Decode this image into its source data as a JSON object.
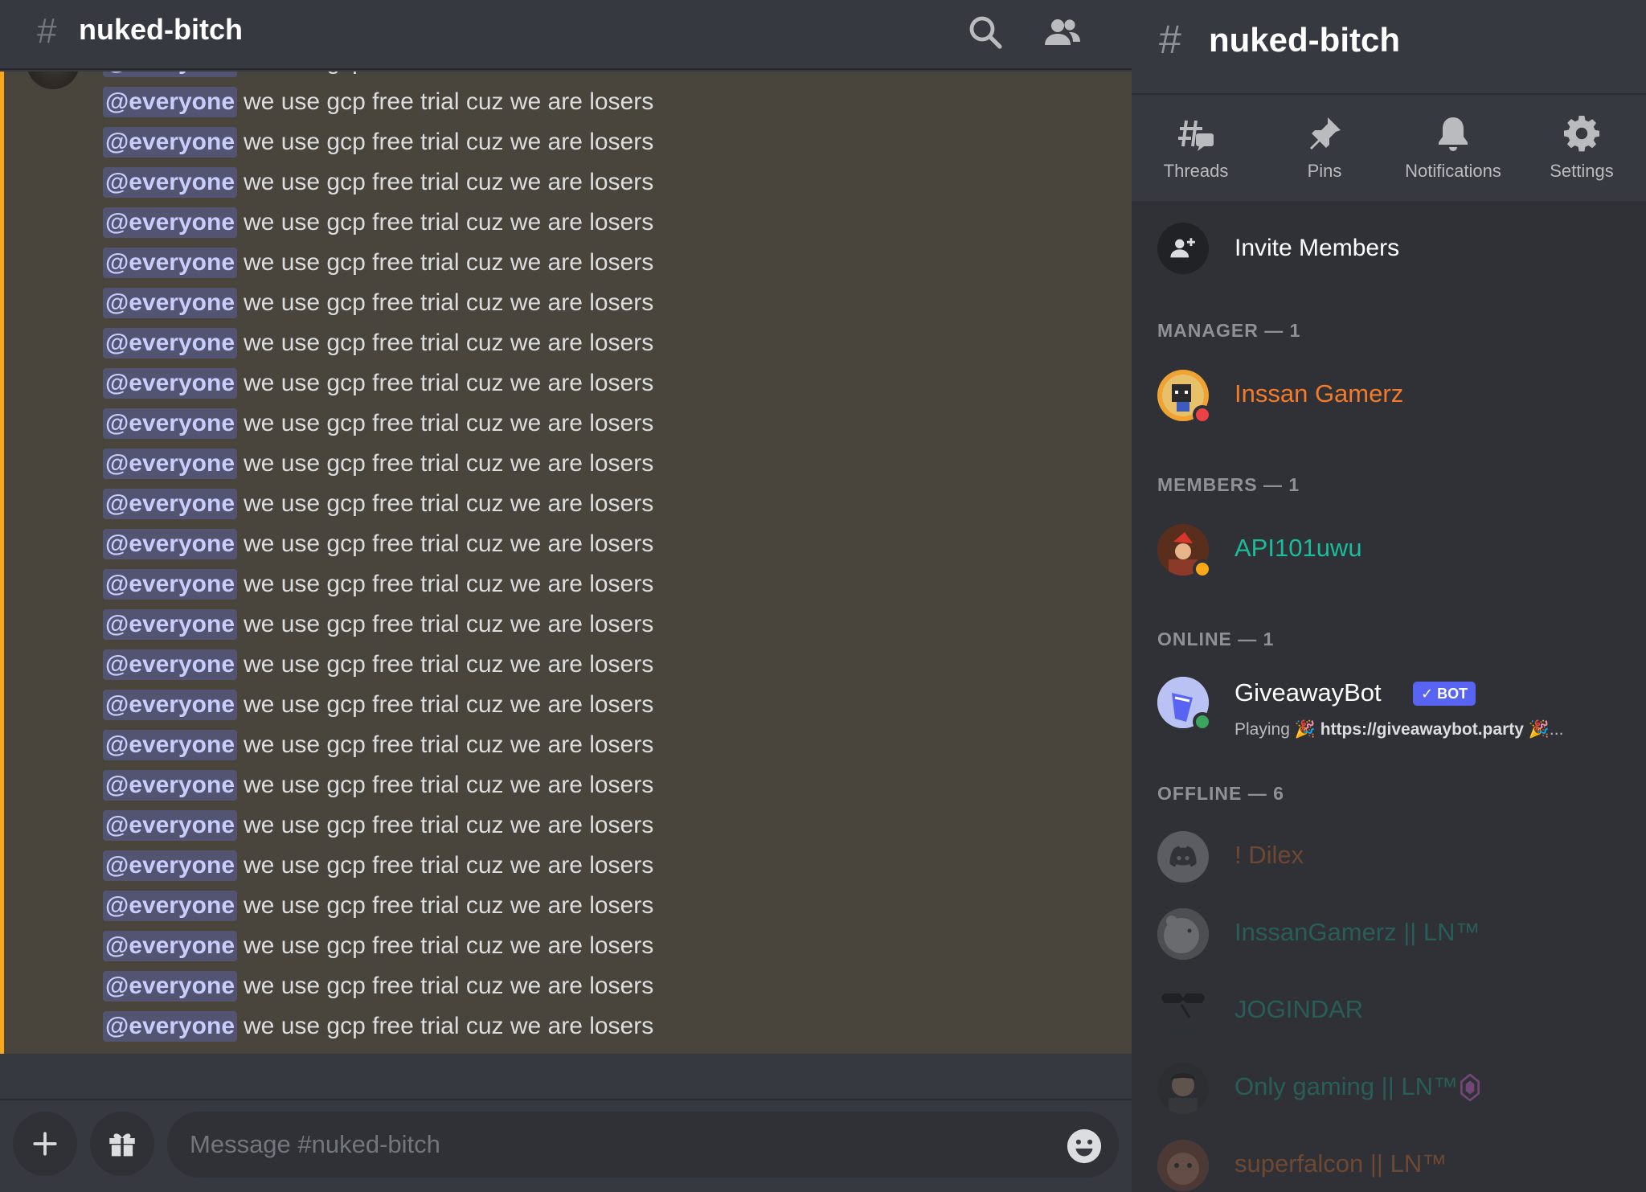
{
  "channel": {
    "name": "nuked-bitch",
    "hash": "#"
  },
  "messages": {
    "mention": "@everyone",
    "text": "we use gcp free trial cuz we are losers",
    "count": 25
  },
  "composer": {
    "placeholder": "Message #nuked-bitch"
  },
  "sidebar": {
    "tabs": [
      {
        "label": "Threads",
        "icon": "threads-icon"
      },
      {
        "label": "Pins",
        "icon": "pin-icon"
      },
      {
        "label": "Notifications",
        "icon": "bell-icon"
      },
      {
        "label": "Settings",
        "icon": "gear-icon"
      }
    ],
    "invite_label": "Invite Members",
    "sections": {
      "manager": "MANAGER — 1",
      "members": "MEMBERS — 1",
      "online": "ONLINE — 1",
      "offline": "OFFLINE — 6"
    },
    "members": [
      {
        "name": "Inssan Gamerz",
        "color": "#f47b2a",
        "status": "dnd"
      },
      {
        "name": "API101uwu",
        "color": "#1abc9c",
        "status": "idle"
      },
      {
        "name": "GiveawayBot",
        "color": "#ffffff",
        "status": "online",
        "bot_tag": "BOT",
        "activity_prefix": "Playing 🎉",
        "activity_link": "https://giveawaybot.party",
        "activity_suffix": "🎉..."
      },
      {
        "name": "! Dilex",
        "color": "#f47b2a"
      },
      {
        "name": "InssanGamerz || LN™",
        "color": "#1abc9c"
      },
      {
        "name": "JOGINDAR",
        "color": "#1abc9c"
      },
      {
        "name": "Only gaming || LN™",
        "color": "#1abc9c"
      },
      {
        "name": "superfalcon  || LN™",
        "color": "#f47b2a"
      }
    ]
  },
  "colors": {
    "accent": "#5865f2",
    "mention_bar": "#faa81a",
    "highlight_bg": "#49443c"
  }
}
